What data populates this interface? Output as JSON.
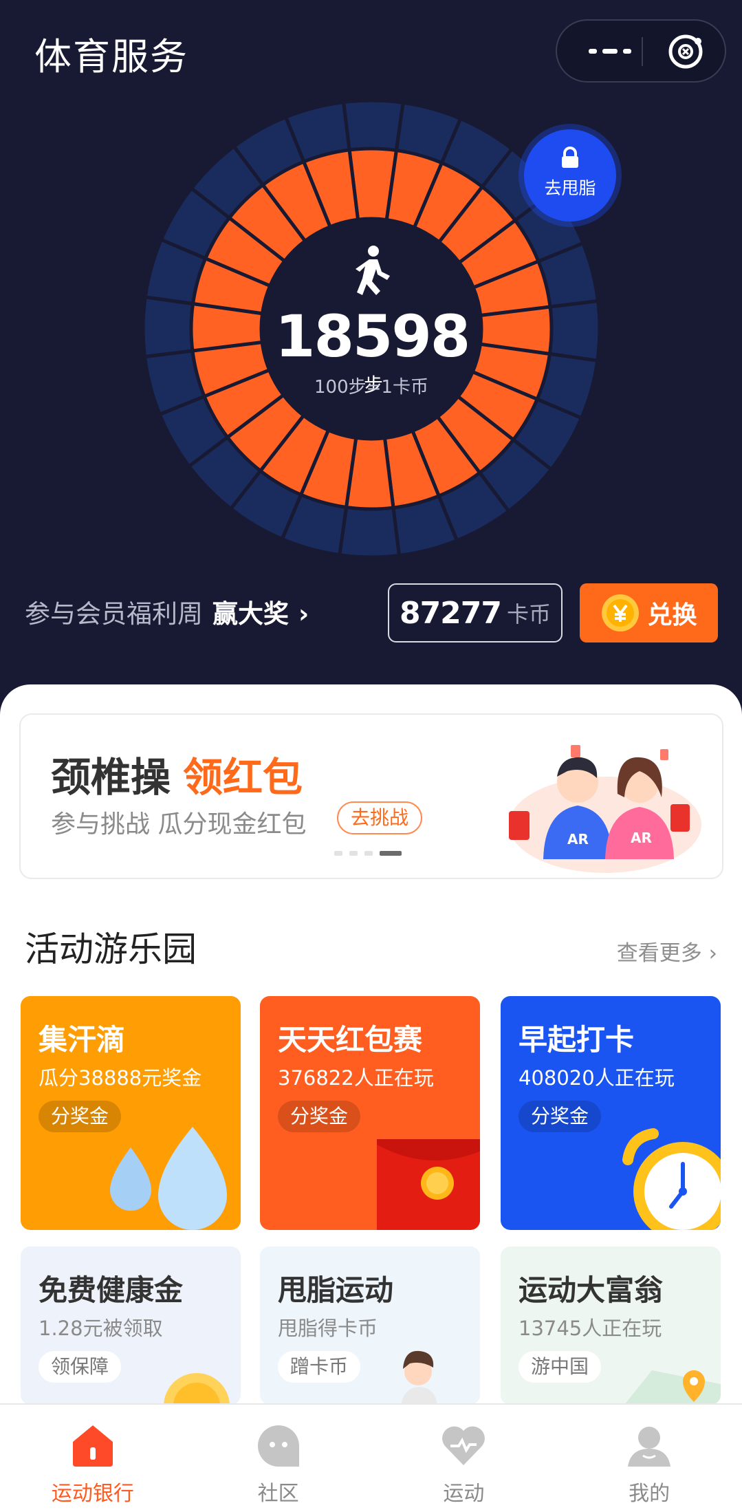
{
  "header": {
    "title": "体育服务",
    "more_icon": "more-dots-icon",
    "close_icon": "close-circle-icon"
  },
  "steps": {
    "count": "18598",
    "unit": "步",
    "rate": "100步=1卡币",
    "progress_segments_filled": 24,
    "progress_segments_total": 24
  },
  "fat_button": {
    "label": "去甩脂",
    "icon": "lock-icon"
  },
  "promo": {
    "text": "参与会员福利周",
    "strong": "赢大奖",
    "chevron": "›"
  },
  "coins": {
    "value": "87277",
    "unit": "卡币"
  },
  "exchange": {
    "label": "兑换",
    "icon": "coin-yen-icon"
  },
  "banner": {
    "title": "颈椎操",
    "highlight": "领红包",
    "subtitle": "参与挑战 瓜分现金红包",
    "button": "去挑战",
    "slide_count": 4,
    "active_slide": 4
  },
  "section": {
    "title": "活动游乐园",
    "more": "查看更多 ›"
  },
  "cards": [
    {
      "name": "集汗滴",
      "sub": "瓜分38888元奖金",
      "tag": "分奖金"
    },
    {
      "name": "天天红包赛",
      "sub": "376822人正在玩",
      "tag": "分奖金"
    },
    {
      "name": "早起打卡",
      "sub": "408020人正在玩",
      "tag": "分奖金"
    },
    {
      "name": "免费健康金",
      "sub": "1.28元被领取",
      "tag": "领保障"
    },
    {
      "name": "甩脂运动",
      "sub": "甩脂得卡币",
      "tag": "蹭卡币"
    },
    {
      "name": "运动大富翁",
      "sub": "13745人正在玩",
      "tag": "游中国"
    }
  ],
  "tabs": [
    {
      "label": "运动银行",
      "icon": "bank-house-icon",
      "active": true
    },
    {
      "label": "社区",
      "icon": "community-face-icon",
      "active": false
    },
    {
      "label": "运动",
      "icon": "heart-pulse-icon",
      "active": false
    },
    {
      "label": "我的",
      "icon": "profile-icon",
      "active": false
    }
  ],
  "colors": {
    "hero_bg": "#181a33",
    "ring_filled": "#ff6222",
    "ring_outer": "#1a2b5e",
    "accent_orange": "#ff6a1a",
    "accent_blue": "#1f4cf0"
  }
}
